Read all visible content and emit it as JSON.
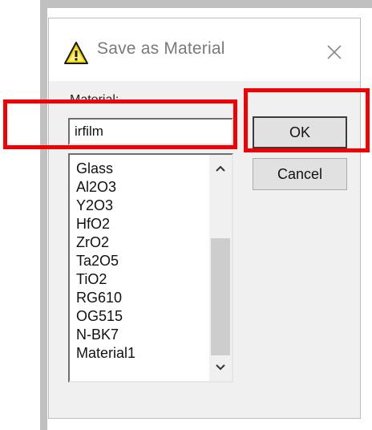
{
  "dialog": {
    "title": "Save as Material",
    "icons": {
      "title": "warning-triangle-icon",
      "close": "close-icon"
    }
  },
  "form": {
    "material_label": "Material:",
    "material_value": "irfilm"
  },
  "list": {
    "items": [
      "Glass",
      "Al2O3",
      "Y2O3",
      "HfO2",
      "ZrO2",
      "Ta2O5",
      "TiO2",
      "RG610",
      "OG515",
      "N-BK7",
      "Material1"
    ],
    "icons": {
      "scroll_up": "chevron-up-icon",
      "scroll_down": "chevron-down-icon"
    }
  },
  "buttons": {
    "ok": "OK",
    "cancel": "Cancel"
  },
  "colors": {
    "highlight": "#f00000",
    "dialog_bg": "#f0f0f0",
    "titlebar_bg": "#ffffff"
  }
}
